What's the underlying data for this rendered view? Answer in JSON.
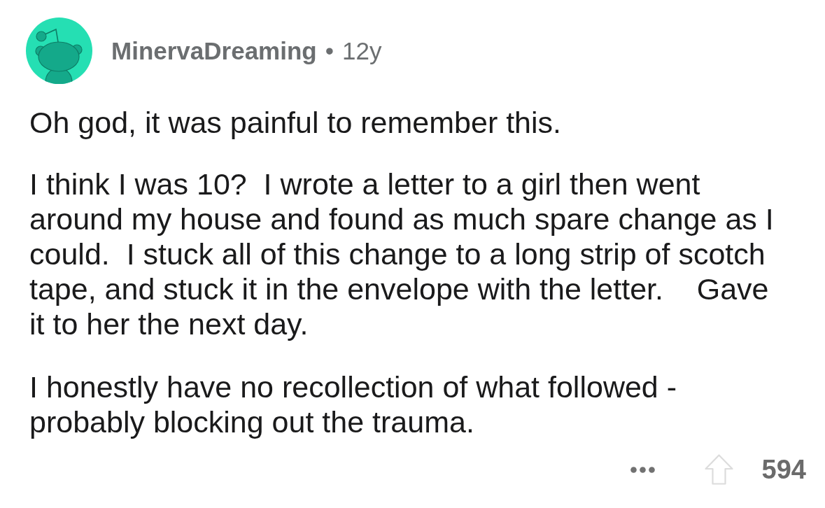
{
  "comment": {
    "author": "MinervaDreaming",
    "separator": "•",
    "age": "12y",
    "paragraphs": [
      [
        "Oh god, it was painful to remember this."
      ],
      [
        "I think I was 10?  I wrote a letter to a girl then went",
        "around my house and found as much spare change as I",
        "could.  I stuck all of this change to a long strip of scotch",
        "tape, and stuck it in the envelope with the letter.    Gave",
        "it to her the next day."
      ],
      [
        "I honestly have no recollection of what followed -",
        "probably blocking out the trauma."
      ]
    ],
    "score": "594"
  }
}
